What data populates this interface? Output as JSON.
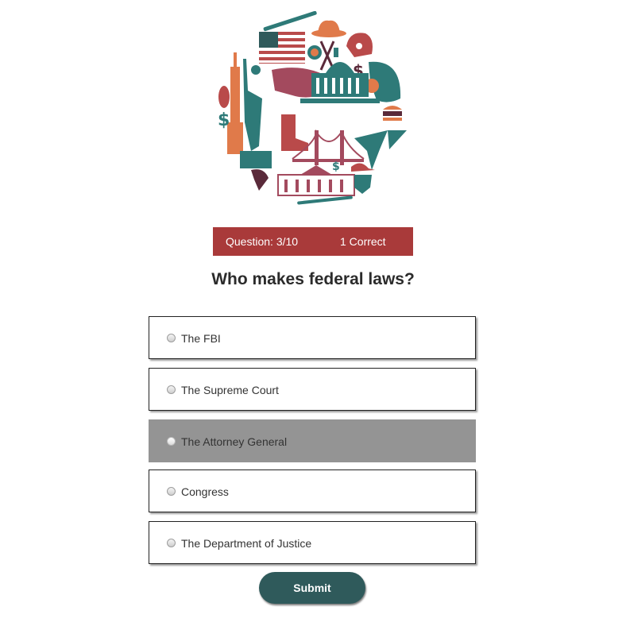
{
  "status": {
    "question_label": "Question: 3/10",
    "correct_label": "1 Correct"
  },
  "question": {
    "text": "Who makes federal laws?"
  },
  "options": [
    {
      "label": "The FBI",
      "selected": false
    },
    {
      "label": "The Supreme Court",
      "selected": false
    },
    {
      "label": "The Attorney General",
      "selected": true
    },
    {
      "label": "Congress",
      "selected": false
    },
    {
      "label": "The Department of Justice",
      "selected": false
    }
  ],
  "submit": {
    "label": "Submit"
  },
  "colors": {
    "status_bg": "#a93a3a",
    "submit_bg": "#2f5a5b",
    "selected_bg": "#949494",
    "accent_orange": "#e07a4a",
    "accent_teal": "#2e7a78",
    "accent_maroon": "#a34a5e"
  }
}
